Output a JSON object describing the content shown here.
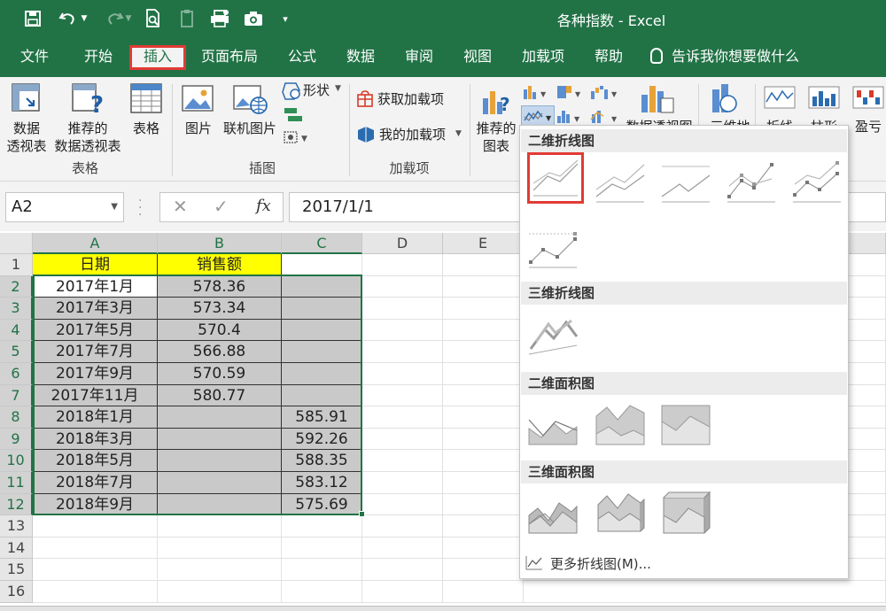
{
  "window": {
    "title": "各种指数 - Excel"
  },
  "tabs": [
    "文件",
    "开始",
    "插入",
    "页面布局",
    "公式",
    "数据",
    "审阅",
    "视图",
    "加载项",
    "帮助"
  ],
  "active_tab": "插入",
  "tell_me": "告诉我你想要做什么",
  "ribbon": {
    "tables": {
      "pivot_line1": "数据",
      "pivot_line2": "透视表",
      "rec_pivot_line1": "推荐的",
      "rec_pivot_line2": "数据透视表",
      "table": "表格",
      "group": "表格"
    },
    "illustrations": {
      "picture": "图片",
      "online_picture": "联机图片",
      "shapes": "形状",
      "group": "插图"
    },
    "addins": {
      "get": "获取加载项",
      "mine": "我的加载项",
      "group": "加载项"
    },
    "charts": {
      "rec_line1": "推荐的",
      "rec_line2": "图表"
    },
    "partial_labels": {
      "pivotchart": "数据透视图",
      "map3d": "三维地",
      "sparkline_line": "折线",
      "sparkline_col": "柱形",
      "sparkline_wl": "盈亏"
    }
  },
  "formula_bar": {
    "name_box": "A2",
    "formula": "2017/1/1",
    "fx": "fx"
  },
  "columns": [
    "A",
    "B",
    "C",
    "D",
    "E"
  ],
  "rows": [
    "1",
    "2",
    "3",
    "4",
    "5",
    "6",
    "7",
    "8",
    "9",
    "10",
    "11",
    "12",
    "13",
    "14",
    "15",
    "16"
  ],
  "sheet": {
    "header": {
      "a": "日期",
      "b": "销售额"
    },
    "data": [
      {
        "a": "2017年1月",
        "b": "578.36",
        "c": ""
      },
      {
        "a": "2017年3月",
        "b": "573.34",
        "c": ""
      },
      {
        "a": "2017年5月",
        "b": "570.4",
        "c": ""
      },
      {
        "a": "2017年7月",
        "b": "566.88",
        "c": ""
      },
      {
        "a": "2017年9月",
        "b": "570.59",
        "c": ""
      },
      {
        "a": "2017年11月",
        "b": "580.77",
        "c": ""
      },
      {
        "a": "2018年1月",
        "b": "",
        "c": "585.91"
      },
      {
        "a": "2018年3月",
        "b": "",
        "c": "592.26"
      },
      {
        "a": "2018年5月",
        "b": "",
        "c": "588.35"
      },
      {
        "a": "2018年7月",
        "b": "",
        "c": "583.12"
      },
      {
        "a": "2018年9月",
        "b": "",
        "c": "575.69"
      }
    ]
  },
  "dropdown": {
    "sections": [
      "二维折线图",
      "三维折线图",
      "二维面积图",
      "三维面积图"
    ],
    "more": "更多折线图(M)..."
  },
  "colors": {
    "excel_green": "#217346",
    "highlight_red": "#e23a35",
    "header_yellow": "#ffff00",
    "shade_gray": "#c9c9c9"
  },
  "icons": [
    "save-icon",
    "undo-icon",
    "redo-icon",
    "print-preview-icon",
    "touch-mode-icon",
    "camera-icon",
    "qat-customize-icon",
    "lightbulb-icon",
    "pivot-table-icon",
    "recommended-pivot-icon",
    "table-icon",
    "picture-icon",
    "online-picture-icon",
    "shapes-icon",
    "smartart-icon",
    "screenshot-icon",
    "store-icon",
    "my-addins-icon",
    "recommended-chart-icon",
    "line-chart-icon"
  ]
}
